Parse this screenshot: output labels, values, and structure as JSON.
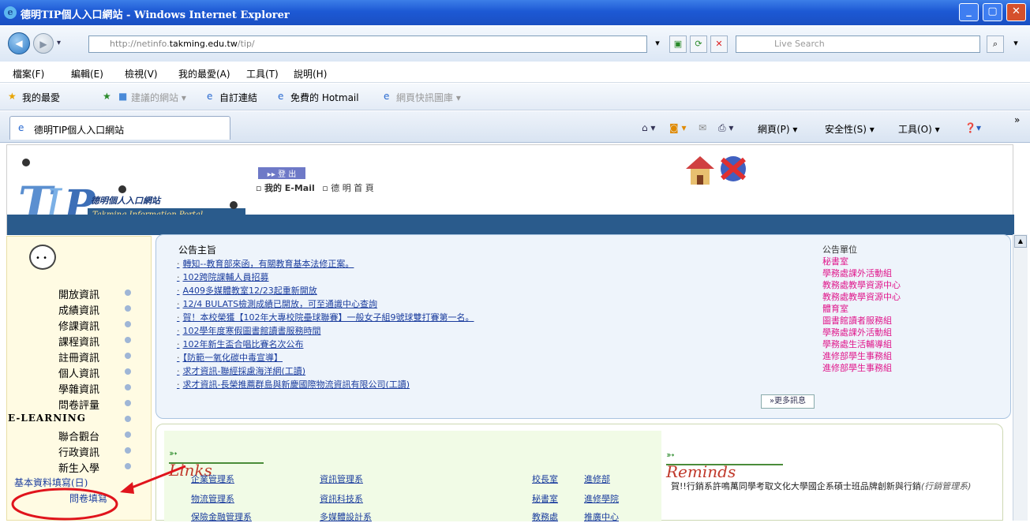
{
  "window": {
    "title": "德明TIP個人入口網站 - Windows Internet Explorer"
  },
  "address": {
    "prefix": "http://netinfo.",
    "host": "takming.edu.tw",
    "path": "/tip/"
  },
  "search": {
    "placeholder": "Live Search"
  },
  "menu": [
    "檔案(F)",
    "編輯(E)",
    "檢視(V)",
    "我的最愛(A)",
    "工具(T)",
    "說明(H)"
  ],
  "favorites": {
    "label": "我的最愛",
    "items": [
      "建議的網站 ▾",
      "自訂連結",
      "免費的 Hotmail",
      "網頁快訊圖庫 ▾"
    ]
  },
  "tab": {
    "label": "德明TIP個人入口網站"
  },
  "commands": [
    "網頁(P) ▾",
    "安全性(S) ▾",
    "工具(O) ▾"
  ],
  "header": {
    "logo_text": "德明個人入口網站",
    "logo_sub": "Takming Information Portal",
    "logout": "登 出",
    "email": "我的 E-Mail",
    "home": "德 明 首 頁"
  },
  "leftnav": [
    "開放資訊",
    "成績資訊",
    "修課資訊",
    "課程資訊",
    "註冊資訊",
    "個人資訊",
    "學雜資訊",
    "問卷評量",
    "E-LEARNING",
    "聯合觀台",
    "行政資訊",
    "新生入學",
    "基本資料填寫(日)",
    "問卷填寫"
  ],
  "news": {
    "heading": "公告主旨",
    "items": [
      "轉知--教育部來函，有關教育基本法修正案。",
      "102跨院課輔人員招募",
      "A409多媒體教室12/23起重新開放",
      "12/4 BULATS檢測成績已開放，可至通識中心查詢",
      "賀！本校榮獲【102年大專校院壘球聯賽】一般女子組9號球雙打賽第一名。",
      "102學年度寒假圖書館讀書服務時間",
      "102年新生盃合唱比賽名次公布",
      "【防範一氧化碳中毒宣導】",
      "求才資訊-聯經採慮海洋網(工讀)",
      "求才資訊-長榮推薦群島與新慶國際物流資訊有限公司(工讀)"
    ],
    "unit_heading": "公告單位",
    "units": [
      "秘書室",
      "學務處課外活動組",
      "教務處教學資源中心",
      "教務處教學資源中心",
      "體育室",
      "圖書館讀者服務組",
      "學務處課外活動組",
      "學務處生活輔導組",
      "進修部學生事務組",
      "進修部學生事務組"
    ],
    "more": "»更多訊息"
  },
  "links": {
    "title": "Links",
    "col1": [
      "企業管理系",
      "物流管理系",
      "保險金融管理系"
    ],
    "col2": [
      "資訊管理系",
      "資訊科技系",
      "多媒體設計系"
    ],
    "col3": [
      "校長室",
      "秘書室",
      "教務處"
    ],
    "col4": [
      "進修部",
      "進修學院",
      "推廣中心"
    ]
  },
  "reminds": {
    "title": "Reminds",
    "text": "賀!!行銷系許鳴萬同學考取文化大學國企系碩士班品牌創新與行銷",
    "text2": "(行銷管理系)"
  },
  "colors": {
    "titlebar": "#1d59d4",
    "header_band": "#2a5b8c",
    "unit_link": "#e0188c",
    "link": "#1b3d9e",
    "annotation": "#e0141c"
  }
}
